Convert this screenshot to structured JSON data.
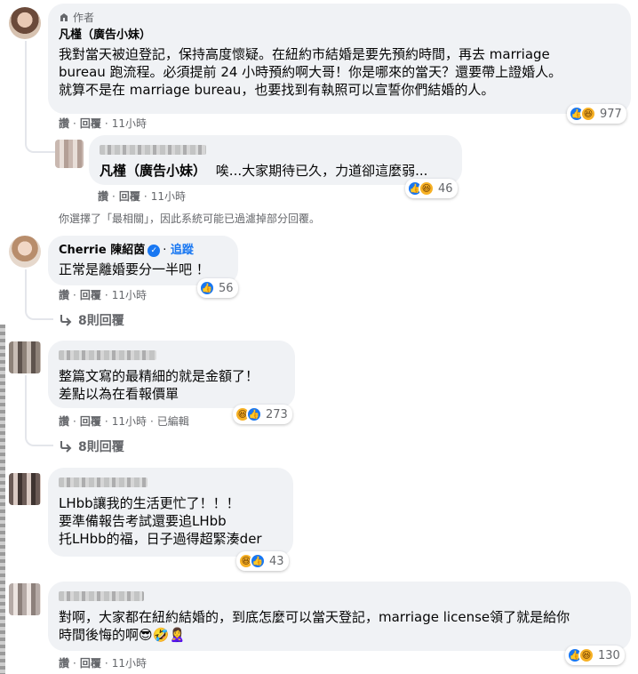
{
  "common": {
    "like": "讚",
    "reply": "回覆",
    "dot": "·",
    "edited": "已編輯"
  },
  "c1": {
    "badge": "作者",
    "author": "凡槿（廣告小妹）",
    "lines": [
      "我對當天被迫登記，保持高度懷疑。在紐約市結婚是要先預約時間，再去 marriage",
      "bureau 跑流程。必須提前 24 小時預約啊大哥！你是哪來的當天？還要帶上證婚人。",
      "就算不是在 marriage bureau，也要找到有執照可以宣誓你們結婚的人。"
    ],
    "time": "11小時",
    "reactions": "977"
  },
  "c2": {
    "author": "凡槿（廣告小妹）",
    "text": "唉...大家期待已久，力道卻這麼弱...",
    "time": "11小時",
    "reactions": "46"
  },
  "notice": "你選擇了「最相關」，因此系統可能已過濾掉部分回覆。",
  "c3": {
    "author": "Cherrie 陳紹茵",
    "follow": "追蹤",
    "text": "正常是離婚要分一半吧 ！",
    "time": "11小時",
    "reactions": "56",
    "replies": "8則回覆"
  },
  "c4": {
    "lines": [
      "整篇文寫的最精細的就是金額了！",
      "差點以為在看報價單"
    ],
    "time": "11小時",
    "reactions": "273",
    "replies": "8則回覆"
  },
  "c5": {
    "lines": [
      "LHbb讓我的生活更忙了！！！",
      "要準備報告考試還要追LHbb",
      "托LHbb的福，日子過得超緊湊der"
    ],
    "reactions": "43"
  },
  "c6": {
    "lines": [
      "對啊，大家都在紐約結婚的，到底怎麼可以當天登記，marriage license領了就是給你",
      "時間後悔的啊😎🤣🙎‍♀️"
    ],
    "time": "11小時",
    "reactions": "130"
  },
  "icons": {
    "like": "like-reaction-icon",
    "haha": "haha-reaction-icon",
    "reply_arrow": "reply-arrow-icon",
    "verified": "verified-badge-icon",
    "author_badge": "author-badge-icon"
  },
  "colors": {
    "bubble": "#f0f2f5",
    "meta_text": "#65676b",
    "like_blue": "#1877f2",
    "haha_yellow": "#f7b125"
  }
}
